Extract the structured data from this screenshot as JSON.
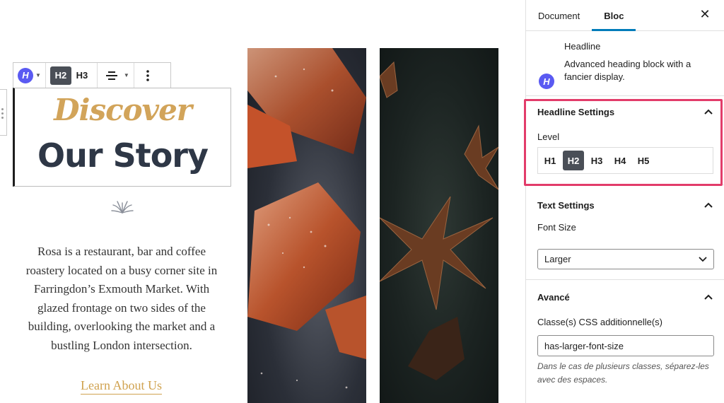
{
  "toolbar": {
    "block_icon_letter": "H",
    "levels": [
      "H2",
      "H3"
    ],
    "active_level": "H2",
    "more_glyph": "⋮"
  },
  "headline": {
    "script_text": "Discover",
    "main_text": "Our Story"
  },
  "about": {
    "paragraph": "Rosa is a restaurant, bar and coffee roastery located on a busy corner site in Farringdon’s Exmouth Market. With glazed frontage on two sides of the building, overlooking the market and a bustling London intersection.",
    "link_label": "Learn About Us"
  },
  "sidebar": {
    "tabs": [
      "Document",
      "Bloc"
    ],
    "active_tab": "Bloc",
    "close_glyph": "✕",
    "block_card": {
      "icon_letter": "H",
      "title": "Headline",
      "description": "Advanced heading block with a fancier display."
    },
    "headline_settings": {
      "title": "Headline Settings",
      "level_label": "Level",
      "levels": [
        "H1",
        "H2",
        "H3",
        "H4",
        "H5"
      ],
      "active_level": "H2"
    },
    "text_settings": {
      "title": "Text Settings",
      "font_size_label": "Font Size",
      "font_size_value": "Larger"
    },
    "advanced": {
      "title": "Avancé",
      "css_label": "Classe(s) CSS additionnelle(s)",
      "css_value": "has-larger-font-size",
      "help": "Dans le cas de plusieurs classes, séparez-les avec des espaces."
    }
  },
  "colors": {
    "accent_blue": "#007cba",
    "highlight": "#e23c6a",
    "gold": "#d2a45a",
    "navy": "#2e3746",
    "block_icon": "#5a5af2"
  }
}
